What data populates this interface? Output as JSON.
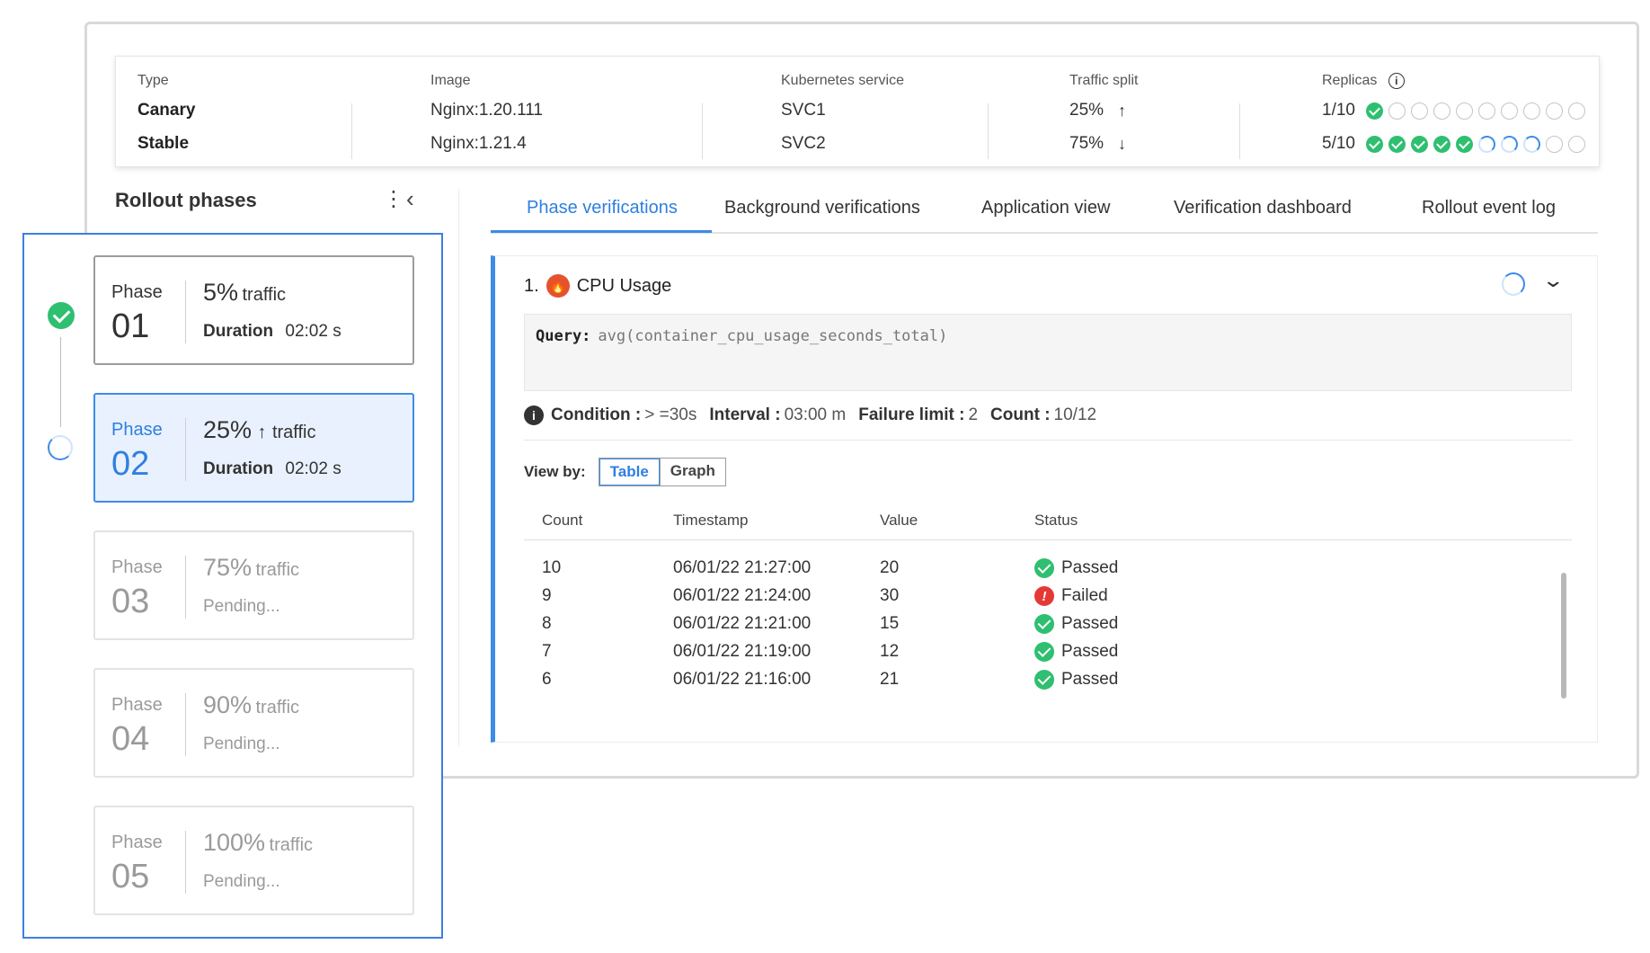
{
  "summary": {
    "headers": {
      "type": "Type",
      "image": "Image",
      "service": "Kubernetes service",
      "traffic": "Traffic split",
      "replicas": "Replicas"
    },
    "canary": {
      "type": "Canary",
      "image": "Nginx:1.20.111",
      "service": "SVC1",
      "traffic": "25%",
      "traffic_arrow": "arrow-up-icon",
      "replicas": "1/10",
      "replica_states": [
        "ok",
        "empty",
        "empty",
        "empty",
        "empty",
        "empty",
        "empty",
        "empty",
        "empty",
        "empty"
      ]
    },
    "stable": {
      "type": "Stable",
      "image": "Nginx:1.21.4",
      "service": "SVC2",
      "traffic": "75%",
      "traffic_arrow": "arrow-down-icon",
      "replicas": "5/10",
      "replica_states": [
        "ok",
        "ok",
        "ok",
        "ok",
        "ok",
        "prog",
        "prog",
        "prog",
        "empty",
        "empty"
      ]
    }
  },
  "rollout": {
    "title": "Rollout phases",
    "phases": [
      {
        "label": "Phase",
        "number": "01",
        "pct": "5%",
        "traffic_word": "traffic",
        "duration_label": "Duration",
        "duration": "02:02 s",
        "state": "done"
      },
      {
        "label": "Phase",
        "number": "02",
        "pct": "25%",
        "traffic_word": "traffic",
        "duration_label": "Duration",
        "duration": "02:02 s",
        "state": "active"
      },
      {
        "label": "Phase",
        "number": "03",
        "pct": "75%",
        "traffic_word": "traffic",
        "pending": "Pending...",
        "state": "pending"
      },
      {
        "label": "Phase",
        "number": "04",
        "pct": "90%",
        "traffic_word": "traffic",
        "pending": "Pending...",
        "state": "pending"
      },
      {
        "label": "Phase",
        "number": "05",
        "pct": "100%",
        "traffic_word": "traffic",
        "pending": "Pending...",
        "state": "pending"
      }
    ]
  },
  "tabs": [
    {
      "label": "Phase verifications",
      "active": true
    },
    {
      "label": "Background verifications",
      "active": false
    },
    {
      "label": "Application view",
      "active": false
    },
    {
      "label": "Verification dashboard",
      "active": false
    },
    {
      "label": "Rollout event log",
      "active": false
    }
  ],
  "verification": {
    "index": "1.",
    "title": "CPU Usage",
    "query_label": "Query:",
    "query": "avg(container_cpu_usage_seconds_total)",
    "conditions": [
      {
        "key": "Condition :",
        "value": "> =30s"
      },
      {
        "key": "Interval :",
        "value": "03:00 m"
      },
      {
        "key": "Failure limit :",
        "value": "2"
      },
      {
        "key": "Count :",
        "value": "10/12"
      }
    ],
    "view_by_label": "View by:",
    "view_table": "Table",
    "view_graph": "Graph",
    "columns": [
      "Count",
      "Timestamp",
      "Value",
      "Status"
    ],
    "rows": [
      {
        "count": "10",
        "timestamp": "06/01/22 21:27:00",
        "value": "20",
        "status": "Passed",
        "ok": true
      },
      {
        "count": "9",
        "timestamp": "06/01/22 21:24:00",
        "value": "30",
        "status": "Failed",
        "ok": false
      },
      {
        "count": "8",
        "timestamp": "06/01/22 21:21:00",
        "value": "15",
        "status": "Passed",
        "ok": true
      },
      {
        "count": "7",
        "timestamp": "06/01/22 21:19:00",
        "value": "12",
        "status": "Passed",
        "ok": true
      },
      {
        "count": "6",
        "timestamp": "06/01/22 21:16:00",
        "value": "21",
        "status": "Passed",
        "ok": true
      }
    ]
  },
  "colors": {
    "accent": "#3d8be8",
    "success": "#2fbf71",
    "danger": "#e53935",
    "prometheus": "#e6522c"
  }
}
